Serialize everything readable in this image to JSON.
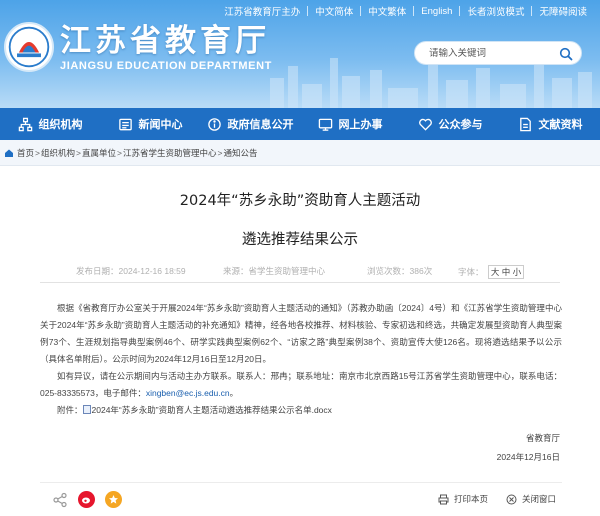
{
  "topbar": {
    "links": [
      "江苏省教育厅主办",
      "中文简体",
      "中文繁体",
      "English",
      "长者浏览模式",
      "无障碍阅读"
    ]
  },
  "header": {
    "title": "江苏省教育厅",
    "subtitle": "JIANGSU EDUCATION DEPARTMENT",
    "search_placeholder": "请输入关键词"
  },
  "nav": {
    "items": [
      {
        "label": "组织机构",
        "icon": "org-icon"
      },
      {
        "label": "新闻中心",
        "icon": "news-icon"
      },
      {
        "label": "政府信息公开",
        "icon": "info-icon"
      },
      {
        "label": "网上办事",
        "icon": "service-icon"
      },
      {
        "label": "公众参与",
        "icon": "heart-icon"
      },
      {
        "label": "文献资料",
        "icon": "docs-icon"
      }
    ]
  },
  "breadcrumb": {
    "items": [
      "首页",
      "组织机构",
      "直属单位",
      "江苏省学生资助管理中心",
      "通知公告"
    ],
    "separator": ">"
  },
  "article": {
    "title_line1": "2024年“苏乡永助”资助育人主题活动",
    "title_line2": "遴选推荐结果公示",
    "meta": {
      "date_label": "发布日期：",
      "date": "2024-12-16 18:59",
      "source_label": "来源：",
      "source": "省学生资助管理中心",
      "views_label": "浏览次数：",
      "views": "386次",
      "font_label": "字体：",
      "font_sizes": [
        "大",
        "中",
        "小"
      ]
    },
    "para1": "根据《省教育厅办公室关于开展2024年“苏乡永助”资助育人主题活动的通知》（苏教办助函〔2024〕4号）和《江苏省学生资助管理中心关于2024年“苏乡永助”资助育人主题活动的补充通知》精神，经各地各校推荐、材料核验、专家初选和终选，共确定发展型资助育人典型案例73个、生涯规划指导典型案例46个、研学实践典型案例62个、“访家之路”典型案例38个、资助宣传大使126名。现将遴选结果予以公示（具体名单附后）。公示时间为2024年12月16日至12月20日。",
    "para2_pre": "如有异议，请在公示期间内与活动主办方联系。联系人：邢冉；联系地址：南京市北京西路15号江苏省学生资助管理中心，联系电话：025-83335573，电子邮件：",
    "email": "xingben@ec.js.edu.cn",
    "para2_post": "。",
    "attachment_label": "附件：",
    "attachment": "2024年“苏乡永助”资助育人主题活动遴选推荐结果公示名单.docx",
    "sign_org": "省教育厅",
    "sign_date": "2024年12月16日"
  },
  "footer": {
    "print_label": "打印本页",
    "close_label": "关闭窗口"
  },
  "colors": {
    "nav_bg": "#1f6fc4",
    "header_top": "#4da3e8",
    "link": "#1a5fae",
    "weibo": "#e6162d",
    "star": "#f5a623"
  }
}
